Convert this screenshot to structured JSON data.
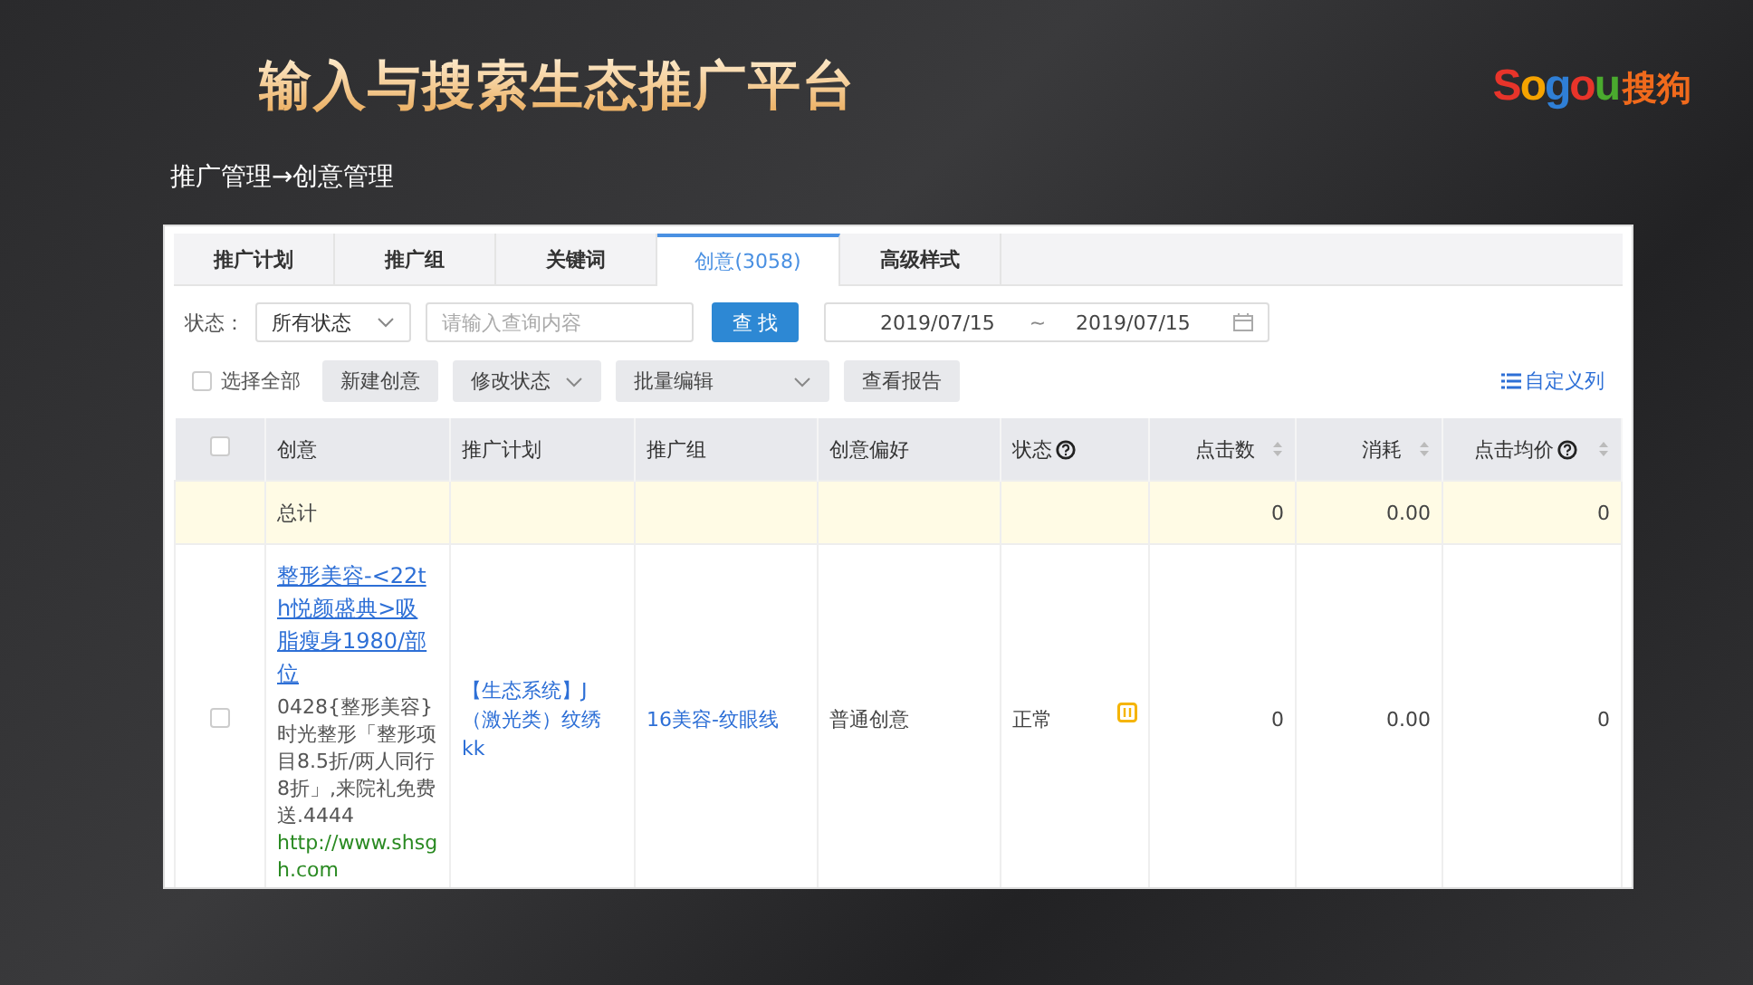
{
  "header": {
    "title": "输入与搜索生态推广平台",
    "logo": {
      "letters": [
        {
          "text": "S",
          "color": "#e8342a"
        },
        {
          "text": "o",
          "color": "#f5a300"
        },
        {
          "text": "g",
          "color": "#2f7fd6"
        },
        {
          "text": "o",
          "color": "#e8342a"
        },
        {
          "text": "u",
          "color": "#4aaa2e"
        }
      ],
      "cn": "搜狗"
    }
  },
  "breadcrumb": "推广管理→创意管理",
  "tabs": [
    {
      "label": "推广计划",
      "selected": false
    },
    {
      "label": "推广组",
      "selected": false
    },
    {
      "label": "关键词",
      "selected": false
    },
    {
      "label": "创意(3058)",
      "selected": true
    },
    {
      "label": "高级样式",
      "selected": false
    }
  ],
  "filter": {
    "status_label": "状态：",
    "status_value": "所有状态",
    "search_placeholder": "请输入查询内容",
    "search_button": "查 找",
    "date_from": "2019/07/15",
    "date_sep": "~",
    "date_to": "2019/07/15"
  },
  "actions": {
    "select_all": {
      "label": "选择全部",
      "checked": false
    },
    "buttons": [
      {
        "label": "新建创意",
        "dropdown": false
      },
      {
        "label": "修改状态",
        "dropdown": true
      },
      {
        "label": "批量编辑",
        "dropdown": true
      },
      {
        "label": "查看报告",
        "dropdown": false
      }
    ],
    "customize": "自定义列"
  },
  "table": {
    "header_checked": false,
    "columns": [
      {
        "label": "创意",
        "kind": "text",
        "help": false,
        "sortable": false
      },
      {
        "label": "推广计划",
        "kind": "text",
        "help": false,
        "sortable": false
      },
      {
        "label": "推广组",
        "kind": "text",
        "help": false,
        "sortable": false
      },
      {
        "label": "创意偏好",
        "kind": "text",
        "help": false,
        "sortable": false
      },
      {
        "label": "状态",
        "kind": "text",
        "help": true,
        "sortable": false
      },
      {
        "label": "点击数",
        "kind": "number",
        "help": false,
        "sortable": true
      },
      {
        "label": "消耗",
        "kind": "number",
        "help": false,
        "sortable": true
      },
      {
        "label": "点击均价",
        "kind": "number",
        "help": true,
        "sortable": true
      }
    ],
    "rows": [
      {
        "kind": "total",
        "label": "总计",
        "clicks": "0",
        "cost": "0.00",
        "avg": "0"
      },
      {
        "kind": "ad",
        "checked": false,
        "title": "整形美容-<22th悦颜盛典>吸脂瘦身1980/部位",
        "description": "0428{整形美容}时光整形「整形项目8.5折/两人同行8折」,来院礼免费送.4444",
        "url": "http://www.shsgh.com",
        "plan": "【生态系统】J（激光类）纹绣kk",
        "group": "16美容-纹眼线",
        "preference": "普通创意",
        "status": "正常",
        "paused": true,
        "clicks": "0",
        "cost": "0.00",
        "avg": "0"
      }
    ]
  }
}
